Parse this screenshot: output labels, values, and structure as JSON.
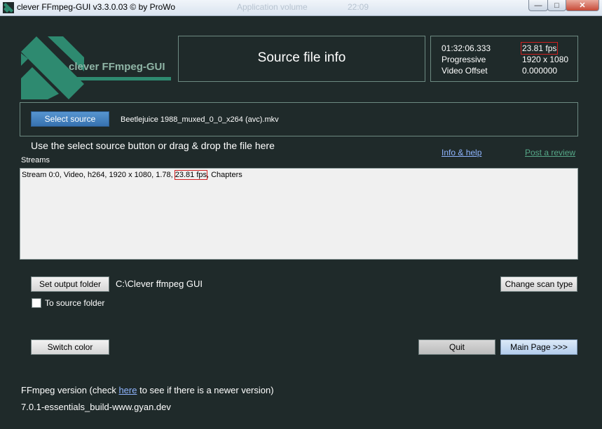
{
  "window": {
    "title": "clever FFmpeg-GUI v3.3.0.03   © by ProWo",
    "background_text": [
      "Application volume",
      "22:09"
    ],
    "controls": {
      "minimize": "—",
      "maximize": "□",
      "close": "✕"
    }
  },
  "logo": {
    "text": "clever FFmpeg-GUI",
    "icon": "diagonal-stripes-logo"
  },
  "header": {
    "title": "Source file info"
  },
  "info": {
    "duration": "01:32:06.333",
    "fps": "23.81 fps",
    "scan_type": "Progressive",
    "resolution": "1920 x 1080",
    "offset_label": "Video Offset",
    "offset_value": "0.000000"
  },
  "source": {
    "button": "Select source",
    "filename": "Beetlejuice 1988_muxed_0_0_x264 (avc).mkv",
    "hint": "Use the select source button or drag & drop the file here"
  },
  "links": {
    "info_help": "Info & help",
    "post_review": "Post a review"
  },
  "streams": {
    "label": "Streams",
    "line_pre": "Stream 0:0, Video, h264, 1920 x 1080, 1.78, ",
    "line_fps": "23.81 fps",
    "line_post": ", Chapters"
  },
  "output": {
    "button": "Set output folder",
    "path": "C:\\Clever ffmpeg GUI",
    "checkbox_label": "To source folder",
    "checkbox_checked": false
  },
  "buttons": {
    "change_scan": "Change scan type",
    "switch_color": "Switch color",
    "quit": "Quit",
    "main_page": "Main Page >>>"
  },
  "footer": {
    "version_pre": "FFmpeg version (check ",
    "version_link": "here",
    "version_post": " to see if there is a newer version)",
    "build": "7.0.1-essentials_build-www.gyan.dev"
  },
  "colors": {
    "background": "#1f2a2a",
    "accent_green": "#2e8a70",
    "link_blue": "#8fb5ff",
    "link_green": "#56a888",
    "highlight_red": "#d02020"
  }
}
